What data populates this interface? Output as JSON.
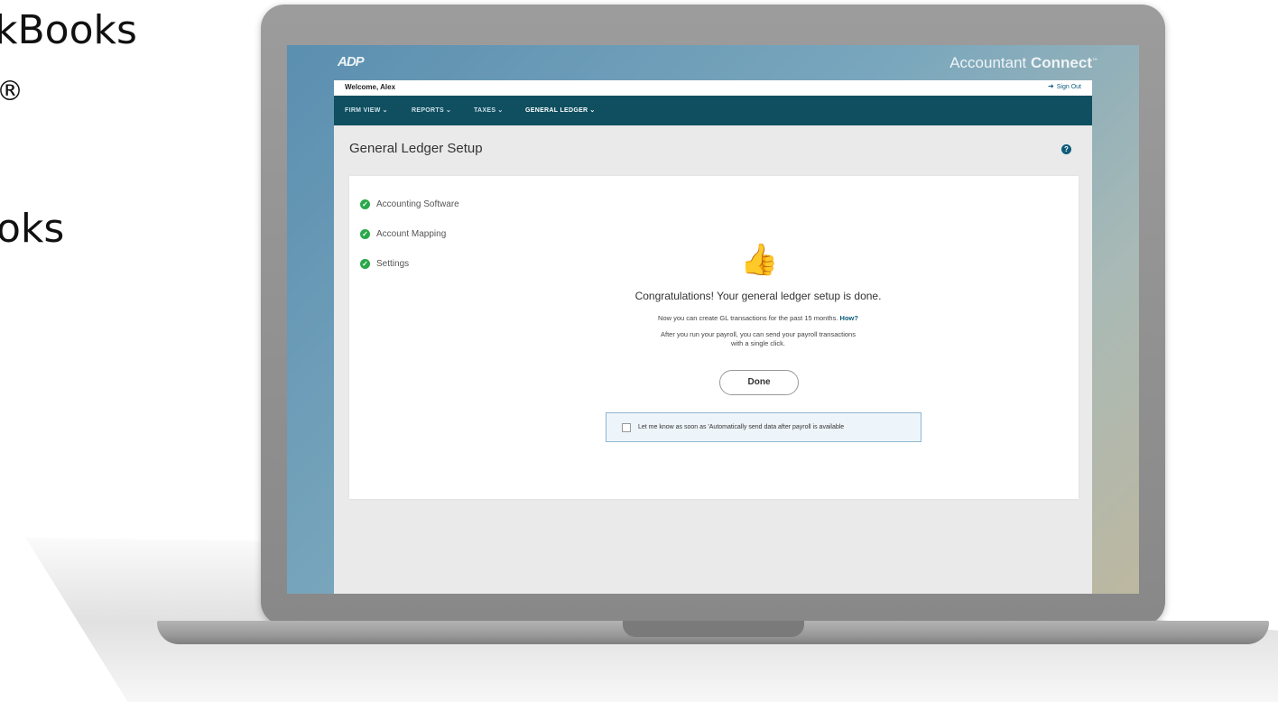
{
  "slide": {
    "line1": "kBooks",
    "line2": "®",
    "line3": "oks"
  },
  "app": {
    "logo": "ADP",
    "brand_light": "Accountant ",
    "brand_bold": "Connect",
    "brand_tm": "™",
    "welcome": "Welcome, Alex",
    "sign_out": "Sign Out",
    "nav": [
      {
        "label": "FIRM VIEW"
      },
      {
        "label": "REPORTS"
      },
      {
        "label": "TAXES"
      },
      {
        "label": "GENERAL LEDGER"
      }
    ],
    "page_title": "General Ledger Setup",
    "steps": [
      {
        "label": "Accounting Software"
      },
      {
        "label": "Account Mapping"
      },
      {
        "label": "Settings"
      }
    ],
    "congrats": "Congratulations! Your general ledger setup is done.",
    "msg1": "Now you can create GL transactions for the past 15 months.",
    "msg1_link": "How?",
    "msg2a": "After you run your payroll, you can send your payroll transactions",
    "msg2b": "with a single click.",
    "done": "Done",
    "notify": "Let me know as soon as 'Automatically send data after payroll is available"
  }
}
